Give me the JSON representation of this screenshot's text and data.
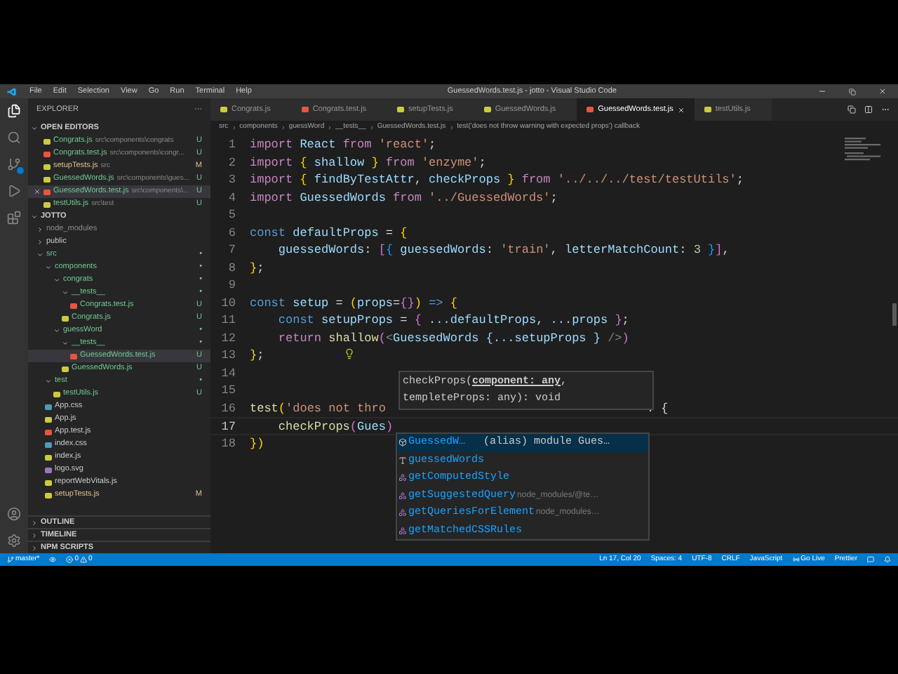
{
  "window": {
    "title": "GuessedWords.test.js - jotto - Visual Studio Code"
  },
  "menu": [
    "File",
    "Edit",
    "Selection",
    "View",
    "Go",
    "Run",
    "Terminal",
    "Help"
  ],
  "sidebar": {
    "title": "EXPLORER",
    "more": "···",
    "open_editors": {
      "title": "OPEN EDITORS",
      "items": [
        {
          "name": "Congrats.js",
          "path": "src\\components\\congrats",
          "status": "U",
          "kind": "js",
          "selected": false
        },
        {
          "name": "Congrats.test.js",
          "path": "src\\components\\congr...",
          "status": "U",
          "kind": "test",
          "selected": false
        },
        {
          "name": "setupTests.js",
          "path": "src",
          "status": "M",
          "kind": "js",
          "selected": false
        },
        {
          "name": "GuessedWords.js",
          "path": "src\\components\\gues...",
          "status": "U",
          "kind": "js",
          "selected": false
        },
        {
          "name": "GuessedWords.test.js",
          "path": "src\\components\\...",
          "status": "U",
          "kind": "test",
          "selected": true
        },
        {
          "name": "testUtils.js",
          "path": "src\\test",
          "status": "U",
          "kind": "js",
          "selected": false
        }
      ]
    },
    "project": {
      "title": "JOTTO",
      "tree": [
        {
          "name": "node_modules",
          "kind": "folder",
          "expanded": false,
          "selected": false,
          "ignored": true
        },
        {
          "name": "public",
          "kind": "folder",
          "expanded": false,
          "selected": false
        },
        {
          "name": "src",
          "kind": "folder",
          "expanded": true,
          "selected": false,
          "status": "•",
          "children": [
            {
              "name": "components",
              "kind": "folder",
              "expanded": true,
              "selected": false,
              "status": "•",
              "children": [
                {
                  "name": "congrats",
                  "kind": "folder",
                  "expanded": true,
                  "selected": false,
                  "status": "•",
                  "children": [
                    {
                      "name": "__tests__",
                      "kind": "folder",
                      "expanded": true,
                      "selected": false,
                      "status": "•",
                      "children": [
                        {
                          "name": "Congrats.test.js",
                          "kind": "test",
                          "selected": false,
                          "status": "U"
                        }
                      ]
                    },
                    {
                      "name": "Congrats.js",
                      "kind": "js",
                      "selected": false,
                      "status": "U"
                    }
                  ]
                },
                {
                  "name": "guessWord",
                  "kind": "folder",
                  "expanded": true,
                  "selected": false,
                  "status": "•",
                  "children": [
                    {
                      "name": "__tests__",
                      "kind": "folder",
                      "expanded": true,
                      "selected": false,
                      "status": "•",
                      "children": [
                        {
                          "name": "GuessedWords.test.js",
                          "kind": "test",
                          "selected": true,
                          "status": "U"
                        }
                      ]
                    },
                    {
                      "name": "GuessedWords.js",
                      "kind": "js",
                      "selected": false,
                      "status": "U"
                    }
                  ]
                }
              ]
            },
            {
              "name": "test",
              "kind": "folder",
              "expanded": true,
              "selected": false,
              "status": "•",
              "children": [
                {
                  "name": "testUtils.js",
                  "kind": "js",
                  "selected": false,
                  "status": "U"
                }
              ]
            },
            {
              "name": "App.css",
              "kind": "css",
              "selected": false
            },
            {
              "name": "App.js",
              "kind": "js",
              "selected": false
            },
            {
              "name": "App.test.js",
              "kind": "test",
              "selected": false
            },
            {
              "name": "index.css",
              "kind": "css",
              "selected": false
            },
            {
              "name": "index.js",
              "kind": "js",
              "selected": false
            },
            {
              "name": "logo.svg",
              "kind": "svg",
              "selected": false
            },
            {
              "name": "reportWebVitals.js",
              "kind": "js",
              "selected": false
            },
            {
              "name": "setupTests.js",
              "kind": "js",
              "selected": false,
              "status": "M"
            }
          ]
        }
      ]
    },
    "panels": [
      "OUTLINE",
      "TIMELINE",
      "NPM SCRIPTS"
    ]
  },
  "tabs": [
    {
      "label": "Congrats.js",
      "kind": "js",
      "selected": false
    },
    {
      "label": "Congrats.test.js",
      "kind": "test",
      "selected": false
    },
    {
      "label": "setupTests.js",
      "kind": "js",
      "selected": false
    },
    {
      "label": "GuessedWords.js",
      "kind": "js",
      "selected": false
    },
    {
      "label": "GuessedWords.test.js",
      "kind": "test",
      "selected": true
    },
    {
      "label": "testUtils.js",
      "kind": "js",
      "selected": false
    }
  ],
  "breadcrumb": [
    "src",
    "components",
    "guessWord",
    "__tests__",
    "GuessedWords.test.js",
    "test('does not throw warning with expected props') callback"
  ],
  "code": [
    {
      "number": "1",
      "current": false,
      "tokens": [
        {
          "text": "import",
          "kind": "kw"
        },
        {
          "text": " React",
          "kind": "var"
        },
        {
          "text": " from",
          "kind": "kw"
        },
        {
          "text": " 'react'",
          "kind": "str"
        },
        {
          "text": ";",
          "kind": "p"
        }
      ]
    },
    {
      "number": "2",
      "current": false,
      "tokens": [
        {
          "text": "import",
          "kind": "kw"
        },
        {
          "text": " {",
          "kind": "b1"
        },
        {
          "text": " shallow",
          "kind": "var"
        },
        {
          "text": " }",
          "kind": "b1"
        },
        {
          "text": " from",
          "kind": "kw"
        },
        {
          "text": " 'enzyme'",
          "kind": "str"
        },
        {
          "text": ";",
          "kind": "p"
        }
      ]
    },
    {
      "number": "3",
      "current": false,
      "tokens": [
        {
          "text": "import",
          "kind": "kw"
        },
        {
          "text": " {",
          "kind": "b1"
        },
        {
          "text": " findByTestAttr",
          "kind": "var"
        },
        {
          "text": ",",
          "kind": "p"
        },
        {
          "text": " checkProps",
          "kind": "var"
        },
        {
          "text": " }",
          "kind": "b1"
        },
        {
          "text": " from",
          "kind": "kw"
        },
        {
          "text": " '../../../test/testUtils'",
          "kind": "str"
        },
        {
          "text": ";",
          "kind": "p"
        }
      ]
    },
    {
      "number": "4",
      "current": false,
      "tokens": [
        {
          "text": "import",
          "kind": "kw"
        },
        {
          "text": " GuessedWords",
          "kind": "var"
        },
        {
          "text": " from",
          "kind": "kw"
        },
        {
          "text": " '../GuessedWords'",
          "kind": "str"
        },
        {
          "text": ";",
          "kind": "p"
        }
      ]
    },
    {
      "number": "5",
      "current": false
    },
    {
      "number": "6",
      "current": false,
      "tokens": [
        {
          "text": "const",
          "kind": "decl"
        },
        {
          "text": " defaultProps",
          "kind": "var"
        },
        {
          "text": " =",
          "kind": "p"
        },
        {
          "text": " {",
          "kind": "b1"
        }
      ]
    },
    {
      "number": "7",
      "current": false,
      "tokens": [
        {
          "text": "    guessedWords",
          "kind": "var"
        },
        {
          "text": ":",
          "kind": "p"
        },
        {
          "text": " [",
          "kind": "b2"
        },
        {
          "text": "{",
          "kind": "b3"
        },
        {
          "text": " guessedWords",
          "kind": "var"
        },
        {
          "text": ":",
          "kind": "p"
        },
        {
          "text": " 'train'",
          "kind": "str"
        },
        {
          "text": ",",
          "kind": "p"
        },
        {
          "text": " letterMatchCount",
          "kind": "var"
        },
        {
          "text": ":",
          "kind": "p"
        },
        {
          "text": " 3",
          "kind": "num"
        },
        {
          "text": " }",
          "kind": "b3"
        },
        {
          "text": "]",
          "kind": "b2"
        },
        {
          "text": ",",
          "kind": "p"
        }
      ]
    },
    {
      "number": "8",
      "current": false,
      "tokens": [
        {
          "text": "}",
          "kind": "b1"
        },
        {
          "text": ";",
          "kind": "p"
        }
      ]
    },
    {
      "number": "9",
      "current": false
    },
    {
      "number": "10",
      "current": false,
      "tokens": [
        {
          "text": "const",
          "kind": "decl"
        },
        {
          "text": " setup",
          "kind": "var"
        },
        {
          "text": " =",
          "kind": "p"
        },
        {
          "text": " (",
          "kind": "b1"
        },
        {
          "text": "props",
          "kind": "var"
        },
        {
          "text": "=",
          "kind": "p"
        },
        {
          "text": "{}",
          "kind": "b2"
        },
        {
          "text": ")",
          "kind": "b1"
        },
        {
          "text": " =>",
          "kind": "decl"
        },
        {
          "text": " {",
          "kind": "b1"
        }
      ]
    },
    {
      "number": "11",
      "current": false,
      "tokens": [
        {
          "text": "    const",
          "kind": "decl"
        },
        {
          "text": " setupProps",
          "kind": "var"
        },
        {
          "text": " =",
          "kind": "p"
        },
        {
          "text": " {",
          "kind": "b2"
        },
        {
          "text": " ...defaultProps",
          "kind": "var"
        },
        {
          "text": ",",
          "kind": "p"
        },
        {
          "text": " ...props",
          "kind": "var"
        },
        {
          "text": " }",
          "kind": "b2"
        },
        {
          "text": ";",
          "kind": "p"
        }
      ]
    },
    {
      "number": "12",
      "current": false,
      "tokens": [
        {
          "text": "    return",
          "kind": "kw"
        },
        {
          "text": " shallow",
          "kind": "fn"
        },
        {
          "text": "(",
          "kind": "b2"
        },
        {
          "text": "<",
          "kind": "dim"
        },
        {
          "text": "GuessedWords",
          "kind": "var"
        },
        {
          "text": " {...setupProps }",
          "kind": "var"
        },
        {
          "text": " />",
          "kind": "dim"
        },
        {
          "text": ")",
          "kind": "b2"
        }
      ]
    },
    {
      "number": "13",
      "current": false,
      "tokens": [
        {
          "text": "}",
          "kind": "b1"
        },
        {
          "text": ";",
          "kind": "p"
        }
      ]
    },
    {
      "number": "14",
      "current": false
    },
    {
      "number": "15",
      "current": false
    },
    {
      "number": "16",
      "current": false,
      "tokens": [
        {
          "text": "test",
          "kind": "fn"
        },
        {
          "text": "(",
          "kind": "b1"
        },
        {
          "text": "'does not thro",
          "kind": "str"
        }
      ],
      "after": ". {"
    },
    {
      "number": "17",
      "current": true,
      "tokens": [
        {
          "text": "    checkProps",
          "kind": "fn"
        },
        {
          "text": "(",
          "kind": "b2"
        },
        {
          "text": "Gues",
          "kind": "var"
        },
        {
          "text": ")",
          "kind": "b2"
        }
      ]
    },
    {
      "number": "18",
      "current": false,
      "tokens": [
        {
          "text": "}",
          "kind": "b1"
        },
        {
          "text": ")",
          "kind": "b1"
        }
      ]
    }
  ],
  "hover": {
    "name": "checkProps(",
    "param": "component: any",
    "rest": ",",
    "line2": "templeteProps: any): void"
  },
  "suggestions": [
    {
      "kind": "module",
      "label": "GuessedW…",
      "detail": "(alias) module Gues…",
      "selected": true
    },
    {
      "kind": "word",
      "label": "guessedWords",
      "selected": false
    },
    {
      "kind": "method",
      "label": "getComputedStyle",
      "selected": false
    },
    {
      "kind": "method",
      "label": "getSuggestedQuery",
      "detail": "node_modules/@te…",
      "selected": false
    },
    {
      "kind": "method",
      "label": "getQueriesForElement",
      "detail": "node_modules…",
      "selected": false
    },
    {
      "kind": "method",
      "label": "getMatchedCSSRules",
      "selected": false
    }
  ],
  "status_bar": {
    "branch": "master*",
    "errors": "0",
    "warnings": "0",
    "right": [
      "Ln 17, Col 20",
      "Spaces: 4",
      "UTF-8",
      "CRLF",
      "JavaScript"
    ],
    "go_live": "Go Live",
    "formatter": "Prettier"
  }
}
